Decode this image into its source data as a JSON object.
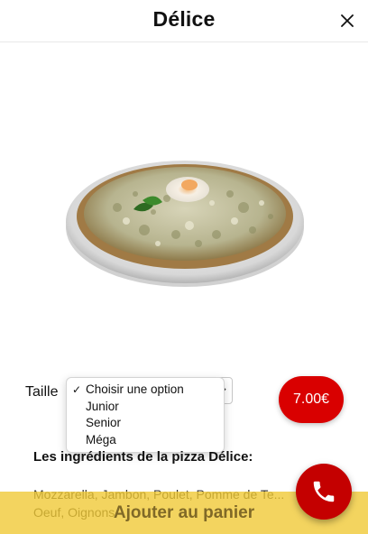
{
  "header": {
    "title": "Délice",
    "close_icon": "close-icon"
  },
  "product": {
    "image_icon": "pizza-image"
  },
  "size": {
    "label": "Taille",
    "selected": "Choisir une option",
    "options": [
      "Choisir une option",
      "Junior",
      "Senior",
      "Méga"
    ],
    "check_mark": "✓"
  },
  "price": {
    "label": "7.00€"
  },
  "ingredients": {
    "heading": "Les ingrédients de la pizza Délice:",
    "text": "Mozzarella, Jambon, Poulet, Pomme de Te... Oeuf, Oignons"
  },
  "cart": {
    "label": "Ajouter au panier"
  },
  "call": {
    "icon": "phone-icon"
  },
  "colors": {
    "accent_red": "#d90000",
    "cart_bar": "#f0c832"
  }
}
